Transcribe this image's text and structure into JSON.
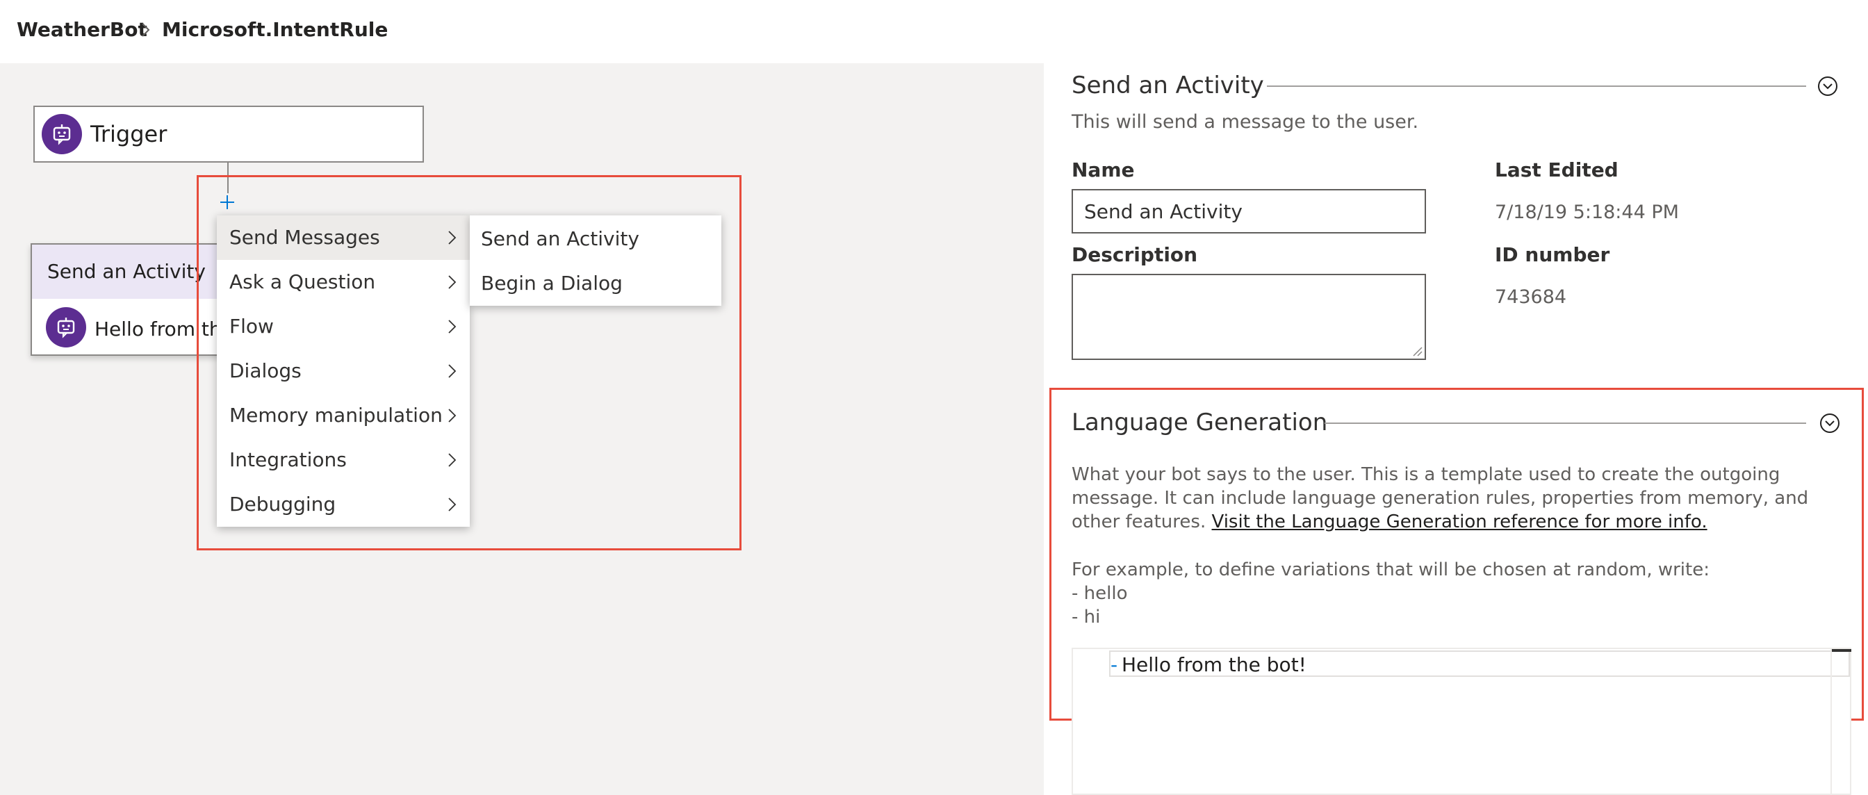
{
  "breadcrumb": {
    "items": [
      {
        "label": "WeatherBot"
      },
      {
        "label": "Microsoft.IntentRule"
      }
    ],
    "separator_icon": "chevron-right-icon"
  },
  "canvas": {
    "trigger_node": {
      "label": "Trigger",
      "icon": "bot-icon"
    },
    "add_button_icon": "plus-icon",
    "activity_node": {
      "title": "Send an Activity",
      "text": "Hello from the",
      "icon": "bot-icon"
    },
    "context_menu": {
      "items": [
        {
          "label": "Send Messages",
          "active": true
        },
        {
          "label": "Ask a Question"
        },
        {
          "label": "Flow"
        },
        {
          "label": "Dialogs"
        },
        {
          "label": "Memory manipulation"
        },
        {
          "label": "Integrations"
        },
        {
          "label": "Debugging"
        }
      ],
      "submenu_items": [
        {
          "label": "Send an Activity"
        },
        {
          "label": "Begin a Dialog"
        }
      ]
    }
  },
  "panel": {
    "send_activity": {
      "title": "Send an Activity",
      "description": "This will send a message to the user.",
      "name_label": "Name",
      "name_value": "Send an Activity",
      "description_label": "Description",
      "description_value": "",
      "last_edited_label": "Last Edited",
      "last_edited_value": "7/18/19 5:18:44 PM",
      "id_label": "ID number",
      "id_value": "743684"
    },
    "language_generation": {
      "title": "Language Generation",
      "help_text": "What your bot says to the user. This is a template used to create the outgoing message. It can include language generation rules, properties from memory, and other features. ",
      "help_link": "Visit the Language Generation reference for more info.",
      "example_intro": "For example, to define variations that will be chosen at random, write:",
      "example_lines": [
        "- hello",
        "- hi"
      ],
      "editor_dash": "-",
      "editor_text": "Hello from the bot!"
    }
  },
  "colors": {
    "accent_purple": "#5c2d91",
    "highlight_red": "#e74c3c",
    "canvas_bg": "#f3f2f1",
    "link_blue": "#0078d4"
  }
}
